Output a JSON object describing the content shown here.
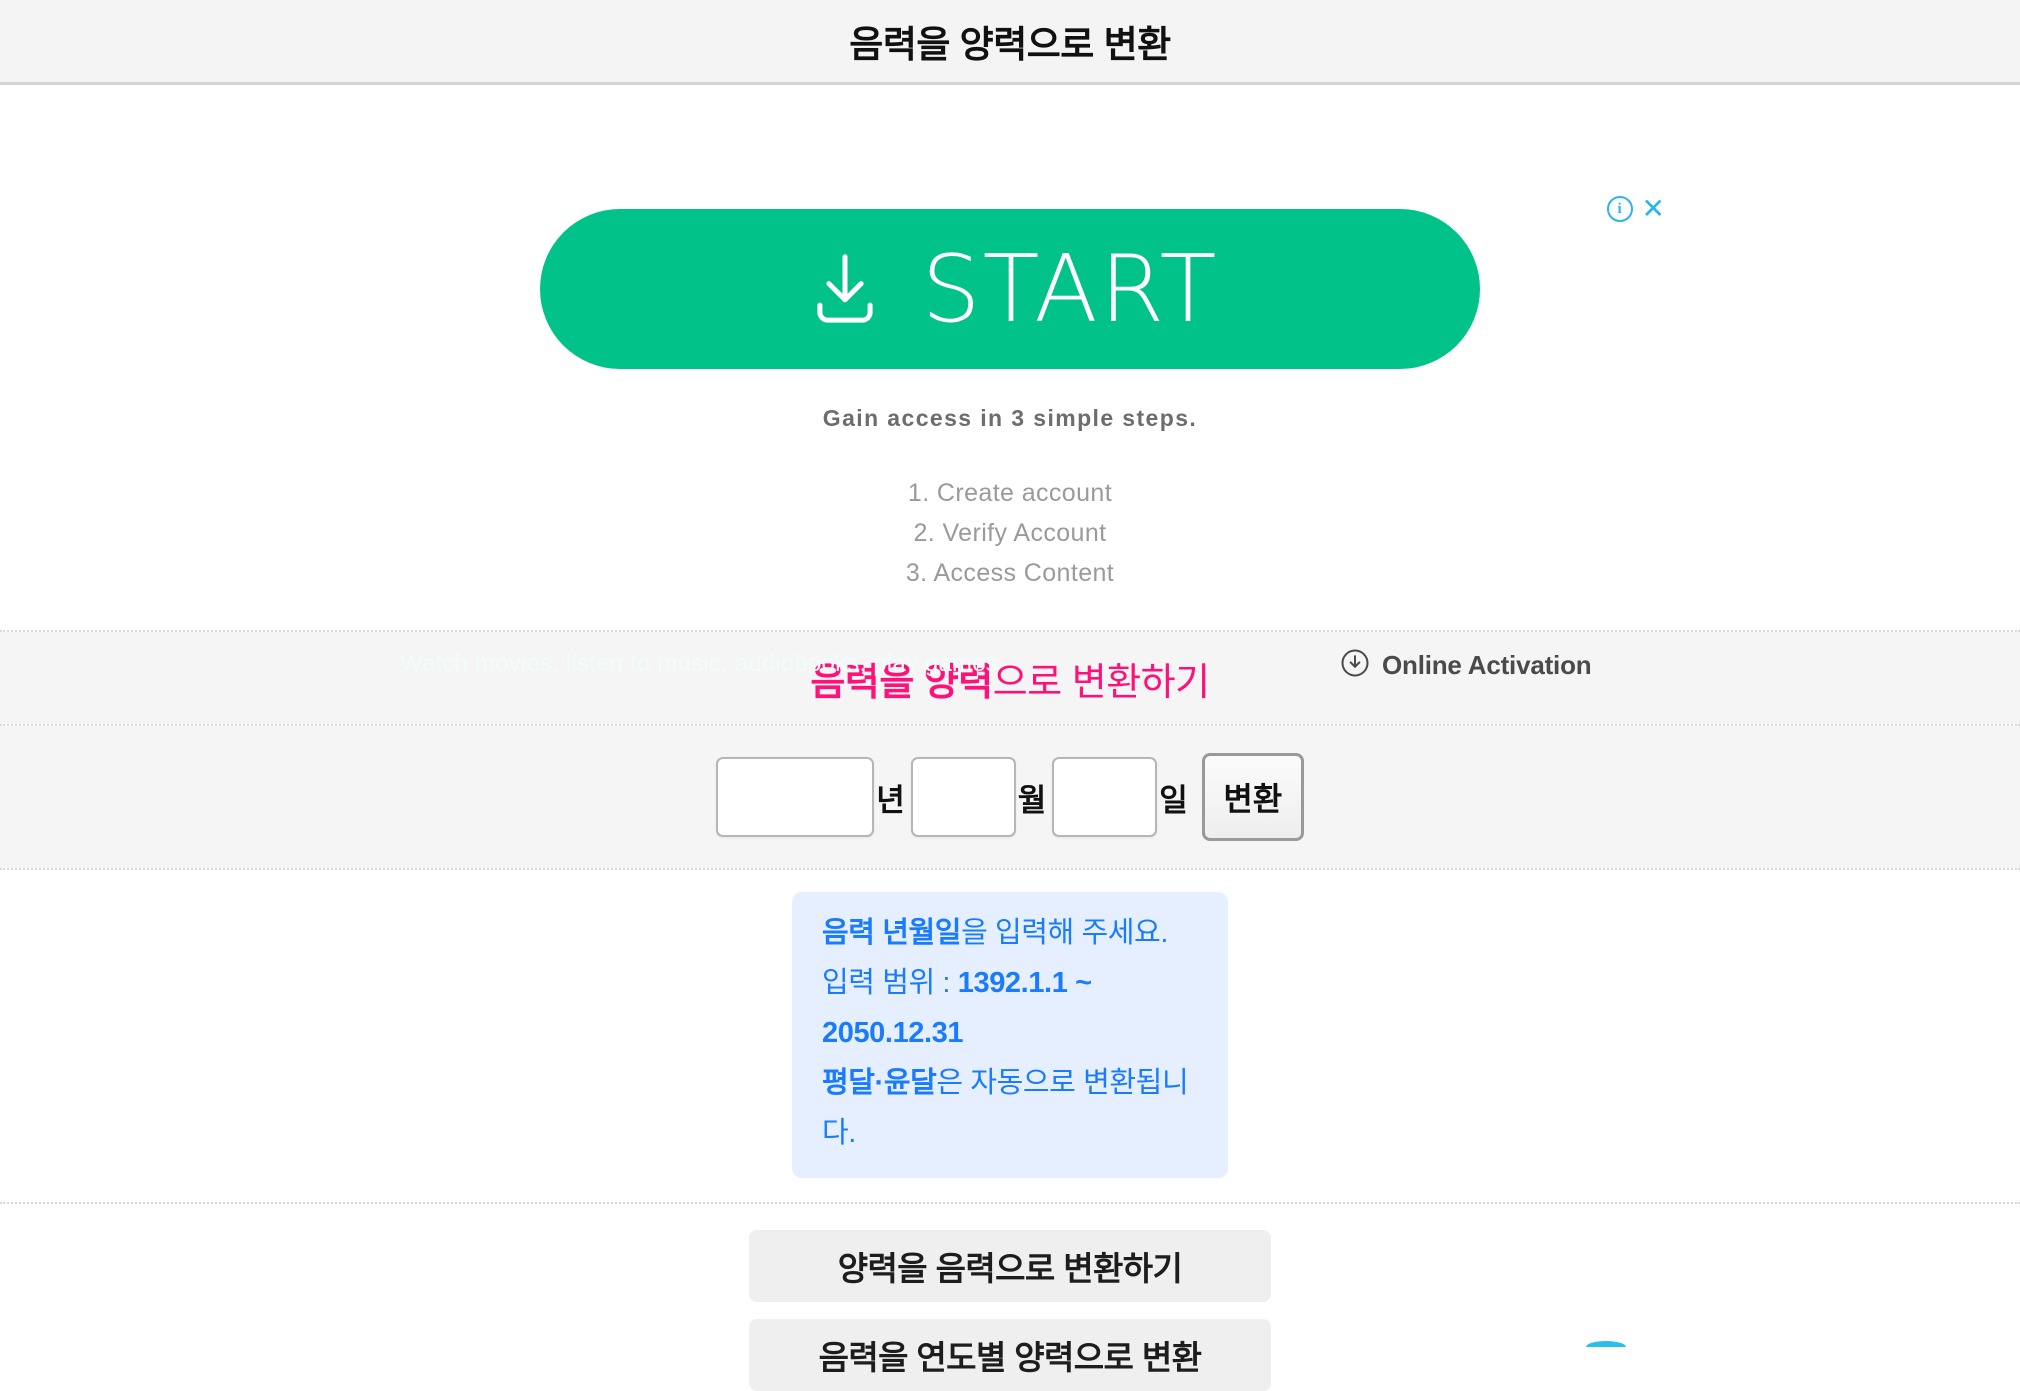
{
  "header": {
    "title": "음력을 양력으로 변환"
  },
  "ad": {
    "adchoices_info_icon": "info-circle-icon",
    "adchoices_info_glyph": "i",
    "close_icon": "close-icon",
    "close_glyph": "✕",
    "start_button_label": "START",
    "start_button_icon": "download-icon",
    "start_button_color": "#01c389",
    "tagline": "Gain access in 3 simple steps.",
    "steps": [
      "1. Create account",
      "2. Verify Account",
      "3. Access Content"
    ],
    "faint_line": "Watch movies, listen to music, audiobooks, play games",
    "activation_icon": "download-circle-icon",
    "activation_label": "Online Activation"
  },
  "converter": {
    "section_title_parts": {
      "strong_one": "음력을 양력",
      "rest": "으로 변환하기"
    },
    "section_title_full": "음력을 양력으로 변환하기",
    "section_title_color": "#ff1178",
    "year_value": "",
    "year_placeholder": "",
    "year_unit": "년",
    "month_value": "",
    "month_placeholder": "",
    "month_unit": "월",
    "day_value": "",
    "day_placeholder": "",
    "day_unit": "일",
    "convert_button_label": "변환"
  },
  "info": {
    "line1_strong": "음력 년월일",
    "line1_rest": "을 입력해 주세요.",
    "line2_label": "입력 범위 : ",
    "line2_range": "1392.1.1 ~ 2050.12.31",
    "line3_strong": "평달·윤달",
    "line3_rest": "은 자동으로 변환됩니다.",
    "text_color": "#1a7bff",
    "background_color": "#e5efff"
  },
  "nav": {
    "button1_label": "양력을 음력으로 변환하기",
    "button2_label": "음력을 연도별 양력으로 변환"
  }
}
